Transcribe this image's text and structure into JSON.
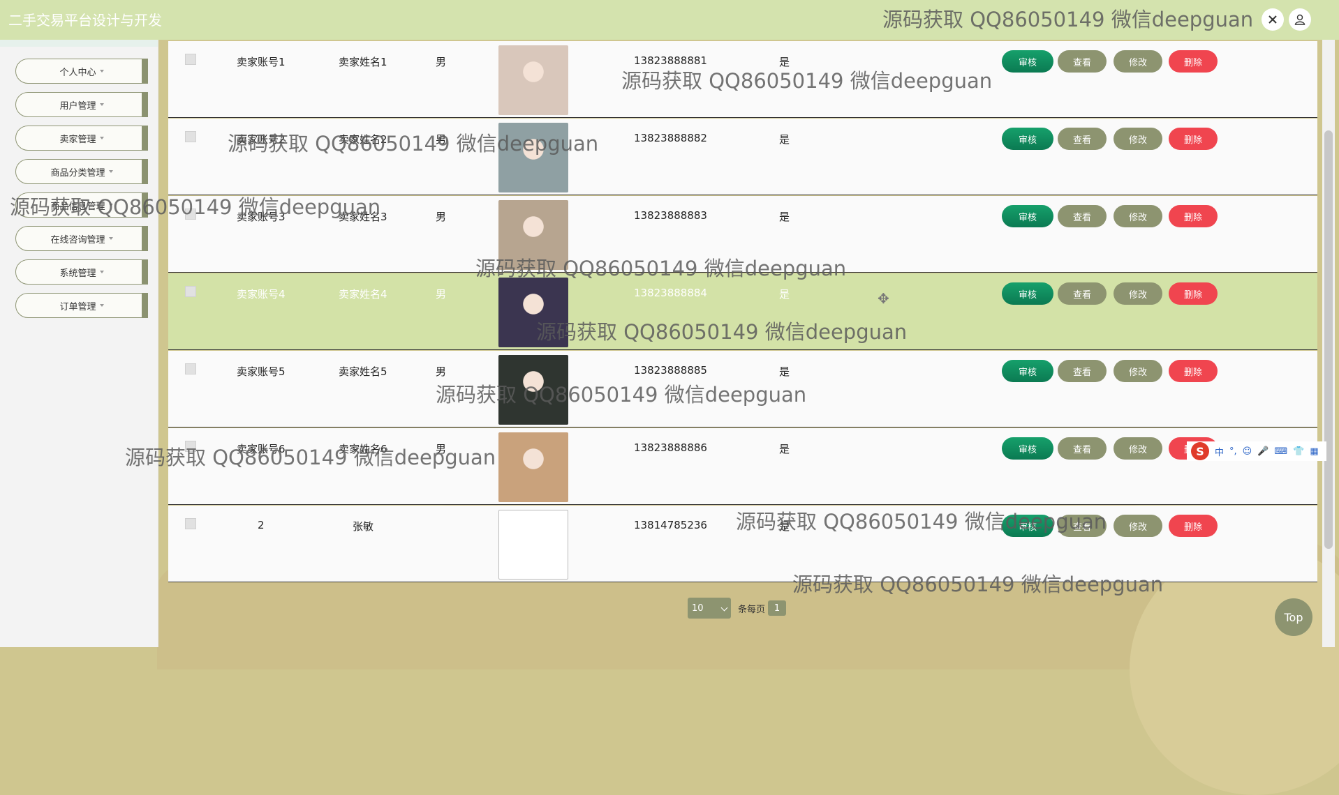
{
  "header": {
    "title": "二手交易平台设计与开发"
  },
  "sidebar": {
    "items": [
      {
        "label": "个人中心"
      },
      {
        "label": "用户管理"
      },
      {
        "label": "卖家管理"
      },
      {
        "label": "商品分类管理"
      },
      {
        "label": "商品信息管理"
      },
      {
        "label": "在线咨询管理"
      },
      {
        "label": "系统管理"
      },
      {
        "label": "订单管理"
      }
    ]
  },
  "table": {
    "rows": [
      {
        "account": "卖家账号1",
        "name": "卖家姓名1",
        "gender": "男",
        "phone": "13823888881",
        "audit": "是",
        "photo_color": "#d9c7bb"
      },
      {
        "account": "卖家账号2",
        "name": "卖家姓名2",
        "gender": "男",
        "phone": "13823888882",
        "audit": "是",
        "photo_color": "#8fa0a3"
      },
      {
        "account": "卖家账号3",
        "name": "卖家姓名3",
        "gender": "男",
        "phone": "13823888883",
        "audit": "是",
        "photo_color": "#b7a590"
      },
      {
        "account": "卖家账号4",
        "name": "卖家姓名4",
        "gender": "男",
        "phone": "13823888884",
        "audit": "是",
        "photo_color": "#3b3550"
      },
      {
        "account": "卖家账号5",
        "name": "卖家姓名5",
        "gender": "男",
        "phone": "13823888885",
        "audit": "是",
        "photo_color": "#2f3530"
      },
      {
        "account": "卖家账号6",
        "name": "卖家姓名6",
        "gender": "男",
        "phone": "13823888886",
        "audit": "是",
        "photo_color": "#c9a27c"
      },
      {
        "account": "2",
        "name": "张敏",
        "gender": "",
        "phone": "13814785236",
        "audit": "是",
        "photo_color": ""
      }
    ],
    "actions": {
      "audit": "审核",
      "view": "查看",
      "edit": "修改",
      "delete": "删除"
    }
  },
  "pagination": {
    "page_size": "10",
    "per_page_label": "条每页",
    "current_page": "1"
  },
  "top_button": "Top",
  "watermark": "源码获取 QQ86050149 微信deepguan",
  "ime": {
    "label": "中"
  },
  "colors": {
    "header": "#d4e3ae",
    "olive": "#8d9470",
    "green": "#0b7a52",
    "red": "#f0454f",
    "selected_row": "#d3e2a7"
  }
}
